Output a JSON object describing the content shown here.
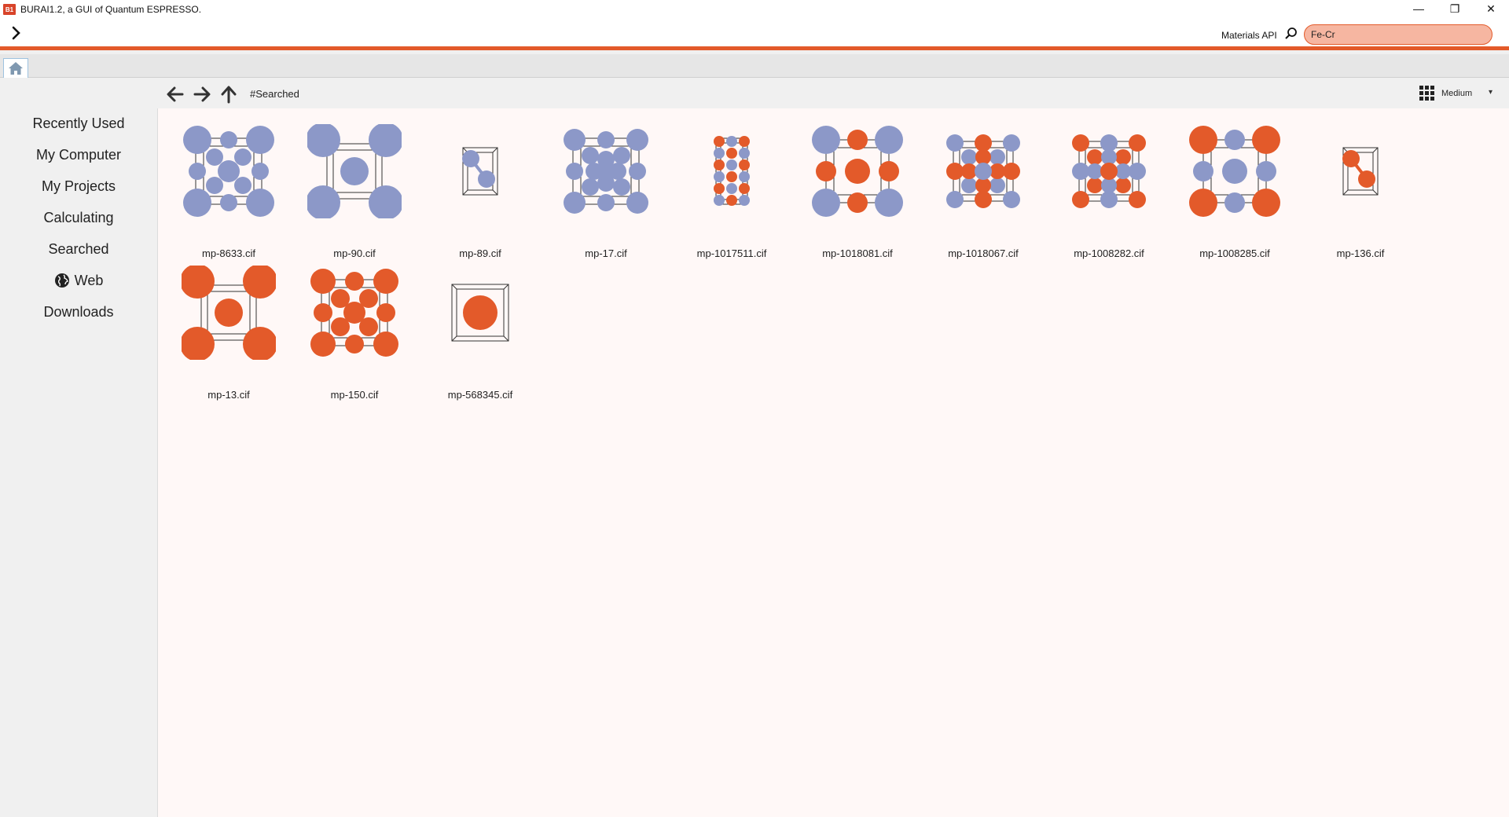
{
  "window": {
    "app_icon_text": "B1",
    "title": "BURAI1.2, a GUI of Quantum ESPRESSO.",
    "minimize_glyph": "—",
    "restore_glyph": "❐",
    "close_glyph": "✕"
  },
  "toolbar": {
    "expand_glyph": "›",
    "api_label": "Materials API",
    "search_value": "Fe-Cr",
    "accent_color": "#e35a2a"
  },
  "sidebar": {
    "items": [
      {
        "label": "Recently Used"
      },
      {
        "label": "My Computer"
      },
      {
        "label": "My Projects"
      },
      {
        "label": "Calculating"
      },
      {
        "label": "Searched"
      },
      {
        "label": "Web"
      },
      {
        "label": "Downloads"
      }
    ]
  },
  "pathbar": {
    "path": "#Searched",
    "view_mode": "Medium"
  },
  "colors": {
    "fe_atom": "#8c98c8",
    "cr_atom": "#e35a2a"
  },
  "files": [
    {
      "name": "mp-8633.cif",
      "thumb": "bcc-fe-large"
    },
    {
      "name": "mp-90.cif",
      "thumb": "bcc-fe-corner"
    },
    {
      "name": "mp-89.cif",
      "thumb": "small-cell-fe"
    },
    {
      "name": "mp-17.cif",
      "thumb": "bcc-fe-dense"
    },
    {
      "name": "mp-1017511.cif",
      "thumb": "mixed-small"
    },
    {
      "name": "mp-1018081.cif",
      "thumb": "mixed-fe-corner"
    },
    {
      "name": "mp-1018067.cif",
      "thumb": "mixed-grid"
    },
    {
      "name": "mp-1008282.cif",
      "thumb": "mixed-grid-2"
    },
    {
      "name": "mp-1008285.cif",
      "thumb": "mixed-cr-corner"
    },
    {
      "name": "mp-136.cif",
      "thumb": "small-cell-cr"
    },
    {
      "name": "mp-13.cif",
      "thumb": "bcc-cr-corner"
    },
    {
      "name": "mp-150.cif",
      "thumb": "bcc-cr-dense"
    },
    {
      "name": "mp-568345.cif",
      "thumb": "single-cr"
    }
  ]
}
